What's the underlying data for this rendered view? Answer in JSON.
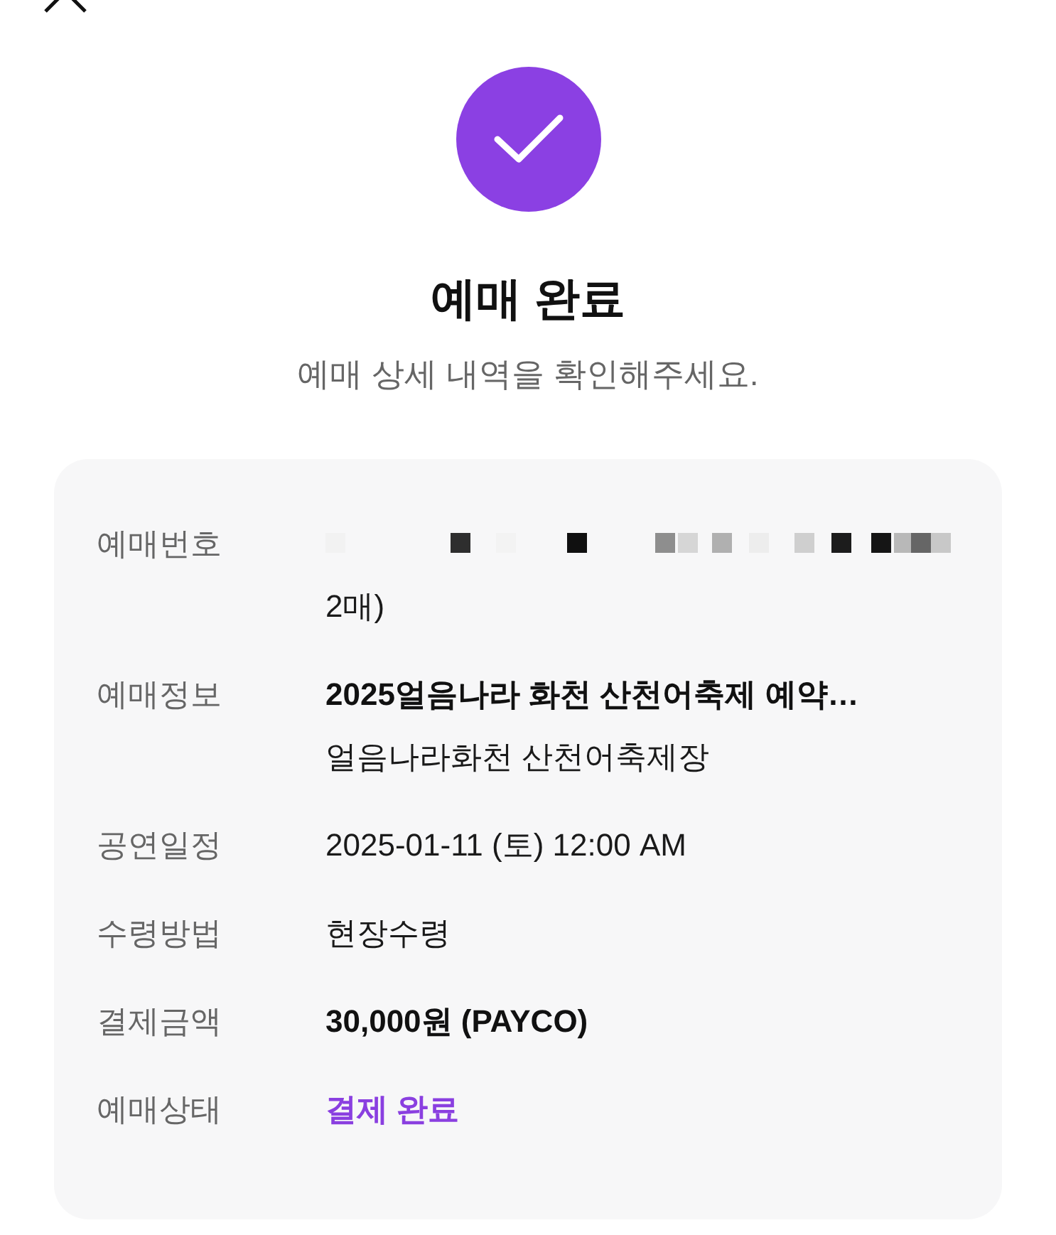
{
  "header": {
    "title": "예매 완료",
    "subtitle": "예매 상세 내역을 확인해주세요."
  },
  "details": [
    {
      "label": "예매번호",
      "kind": "redacted",
      "lines": [
        "2매)"
      ]
    },
    {
      "label": "예매정보",
      "kind": "bold",
      "lines": [
        "2025얼음나라 화천 산천어축제 예약…",
        "얼음나라화천 산천어축제장"
      ]
    },
    {
      "label": "공연일정",
      "kind": "plain",
      "lines": [
        "2025-01-11 (토) 12:00 AM"
      ]
    },
    {
      "label": "수령방법",
      "kind": "plain",
      "lines": [
        "현장수령"
      ]
    },
    {
      "label": "결제금액",
      "kind": "bold",
      "lines": [
        "30,000원 (PAYCO)"
      ]
    },
    {
      "label": "예매상태",
      "kind": "accent",
      "lines": [
        "결제 완료"
      ]
    }
  ]
}
